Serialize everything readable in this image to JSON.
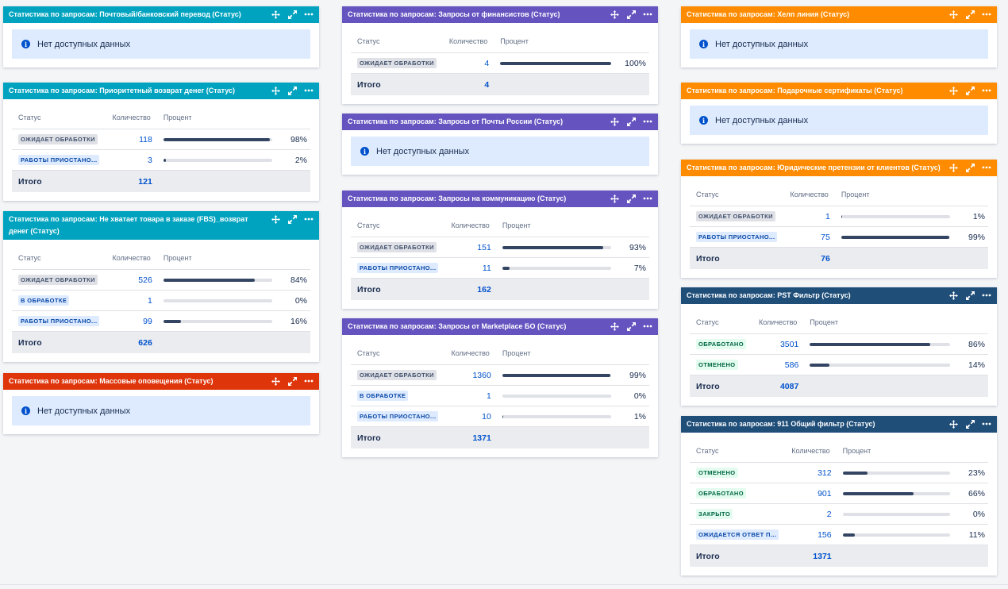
{
  "common": {
    "col_status": "Статус",
    "col_count": "Количество",
    "col_percent": "Процент",
    "total_label": "Итого",
    "no_data": "Нет доступных данных"
  },
  "colors": {
    "teal": "#00a3bf",
    "purple": "#6554c0",
    "orange": "#ff8b00",
    "red": "#de350b",
    "navy": "#1f4e79"
  },
  "gadgets": [
    {
      "id": "g1",
      "title": "Статистика по запросам: Почтовый/банковский перевод (Статус)",
      "color": "teal",
      "nodata": true
    },
    {
      "id": "g2",
      "title": "Статистика по запросам: Приоритетный возврат денег (Статус)",
      "color": "teal",
      "rows": [
        {
          "status": "ОЖИДАЕТ ОБРАБОТКИ",
          "tone": "gray",
          "count": "118",
          "fraction": 0.98,
          "percent": "98%"
        },
        {
          "status": "РАБОТЫ ПРИОСТАНО...",
          "tone": "blue",
          "count": "3",
          "fraction": 0.02,
          "percent": "2%"
        }
      ],
      "total": "121"
    },
    {
      "id": "g3",
      "title": "Статистика по запросам: Не хватает товара в заказе (FBS)_возврат денег (Статус)",
      "color": "teal",
      "rows": [
        {
          "status": "ОЖИДАЕТ ОБРАБОТКИ",
          "tone": "gray",
          "count": "526",
          "fraction": 0.84,
          "percent": "84%"
        },
        {
          "status": "В ОБРАБОТКЕ",
          "tone": "blue",
          "count": "1",
          "fraction": 0.0,
          "percent": "0%"
        },
        {
          "status": "РАБОТЫ ПРИОСТАНО...",
          "tone": "blue",
          "count": "99",
          "fraction": 0.16,
          "percent": "16%"
        }
      ],
      "total": "626"
    },
    {
      "id": "g4",
      "title": "Статистика по запросам: Массовые оповещения (Статус)",
      "color": "red",
      "nodata": true
    },
    {
      "id": "g5",
      "title": "Статистика по запросам: Запросы от финансистов (Статус)",
      "color": "purple",
      "rows": [
        {
          "status": "ОЖИДАЕТ ОБРАБОТКИ",
          "tone": "gray",
          "count": "4",
          "fraction": 1.0,
          "percent": "100%"
        }
      ],
      "total": "4"
    },
    {
      "id": "g6",
      "title": "Статистика по запросам: Запросы от Почты России (Статус)",
      "color": "purple",
      "nodata": true
    },
    {
      "id": "g7",
      "title": "Статистика по запросам: Запросы на коммуникацию (Статус)",
      "color": "purple",
      "rows": [
        {
          "status": "ОЖИДАЕТ ОБРАБОТКИ",
          "tone": "gray",
          "count": "151",
          "fraction": 0.93,
          "percent": "93%"
        },
        {
          "status": "РАБОТЫ ПРИОСТАНО...",
          "tone": "blue",
          "count": "11",
          "fraction": 0.07,
          "percent": "7%"
        }
      ],
      "total": "162"
    },
    {
      "id": "g8",
      "title": "Статистика по запросам: Запросы от Marketplace БО (Статус)",
      "color": "purple",
      "rows": [
        {
          "status": "ОЖИДАЕТ ОБРАБОТКИ",
          "tone": "gray",
          "count": "1360",
          "fraction": 0.99,
          "percent": "99%"
        },
        {
          "status": "В ОБРАБОТКЕ",
          "tone": "blue",
          "count": "1",
          "fraction": 0.0,
          "percent": "0%"
        },
        {
          "status": "РАБОТЫ ПРИОСТАНО...",
          "tone": "blue",
          "count": "10",
          "fraction": 0.01,
          "percent": "1%"
        }
      ],
      "total": "1371"
    },
    {
      "id": "g9",
      "title": "Статистика по запросам: Хелп линия (Статус)",
      "color": "orange",
      "nodata": true
    },
    {
      "id": "g10",
      "title": "Статистика по запросам: Подарочные сертификаты (Статус)",
      "color": "orange",
      "nodata": true
    },
    {
      "id": "g11",
      "title": "Статистика по запросам: Юридические претензии от клиентов (Статус)",
      "color": "orange",
      "rows": [
        {
          "status": "ОЖИДАЕТ ОБРАБОТКИ",
          "tone": "gray",
          "count": "1",
          "fraction": 0.01,
          "percent": "1%"
        },
        {
          "status": "РАБОТЫ ПРИОСТАНО...",
          "tone": "blue",
          "count": "75",
          "fraction": 0.99,
          "percent": "99%"
        }
      ],
      "total": "76"
    },
    {
      "id": "g12",
      "title": "Статистика по запросам: PST Фильтр (Статус)",
      "color": "navy",
      "rows": [
        {
          "status": "ОБРАБОТАНО",
          "tone": "green",
          "count": "3501",
          "fraction": 0.86,
          "percent": "86%"
        },
        {
          "status": "ОТМЕНЕНО",
          "tone": "green",
          "count": "586",
          "fraction": 0.14,
          "percent": "14%"
        }
      ],
      "total": "4087"
    },
    {
      "id": "g13",
      "title": "Статистика по запросам: 911 Общий фильтр (Статус)",
      "color": "navy",
      "rows": [
        {
          "status": "ОТМЕНЕНО",
          "tone": "green",
          "count": "312",
          "fraction": 0.23,
          "percent": "23%"
        },
        {
          "status": "ОБРАБОТАНО",
          "tone": "green",
          "count": "901",
          "fraction": 0.66,
          "percent": "66%"
        },
        {
          "status": "ЗАКРЫТО",
          "tone": "green",
          "count": "2",
          "fraction": 0.0,
          "percent": "0%"
        },
        {
          "status": "ОЖИДАЕТСЯ ОТВЕТ П...",
          "tone": "blue",
          "count": "156",
          "fraction": 0.11,
          "percent": "11%"
        }
      ],
      "total": "1371"
    }
  ]
}
